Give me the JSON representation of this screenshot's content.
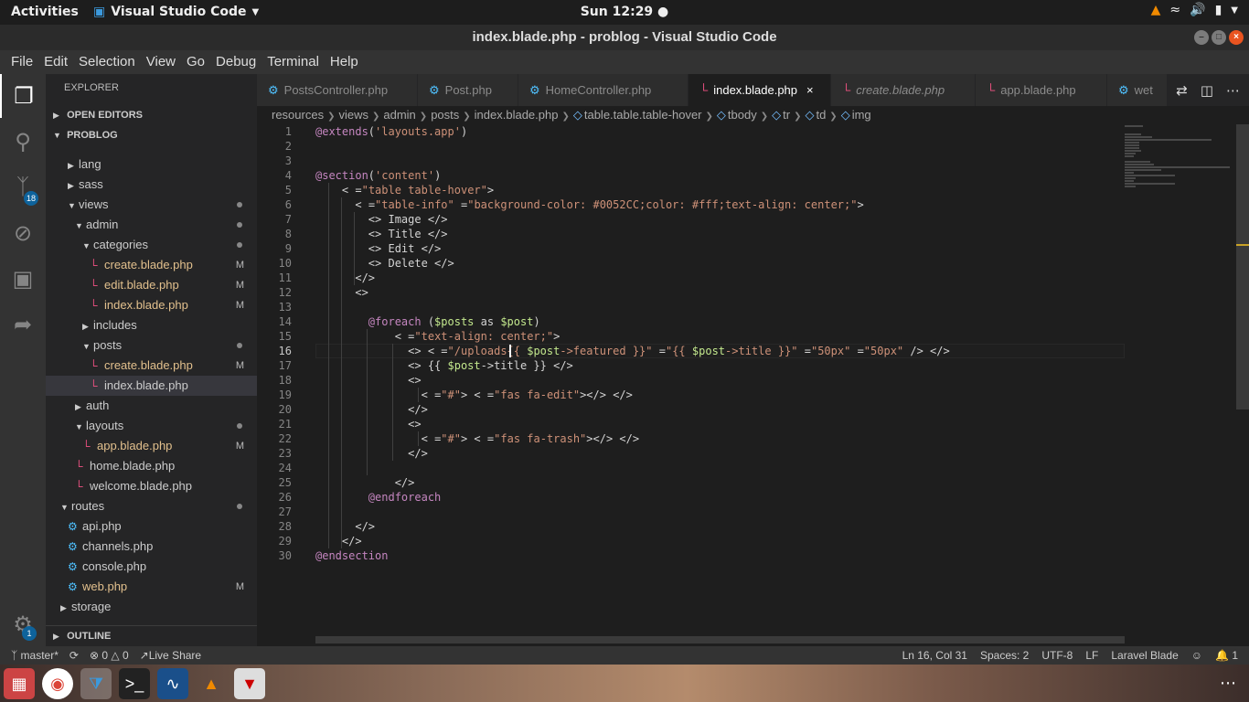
{
  "topbar": {
    "activities": "Activities",
    "app_name": "Visual Studio Code",
    "clock": "Sun 12:29 ●"
  },
  "window": {
    "title": "index.blade.php - problog - Visual Studio Code"
  },
  "menu": [
    "File",
    "Edit",
    "Selection",
    "View",
    "Go",
    "Debug",
    "Terminal",
    "Help"
  ],
  "activity": {
    "scm_badge": "18",
    "settings_badge": "1"
  },
  "sidebar": {
    "title": "EXPLORER",
    "open_editors": "OPEN EDITORS",
    "project": "PROBLOG",
    "outline": "OUTLINE",
    "rows": [
      {
        "label": "lang",
        "depth": 2,
        "kind": "folder",
        "open": false
      },
      {
        "label": "sass",
        "depth": 2,
        "kind": "folder",
        "open": false
      },
      {
        "label": "views",
        "depth": 2,
        "kind": "folder",
        "open": true,
        "dot": true
      },
      {
        "label": "admin",
        "depth": 3,
        "kind": "folder",
        "open": true,
        "dot": true
      },
      {
        "label": "categories",
        "depth": 4,
        "kind": "folder",
        "open": true,
        "dot": true
      },
      {
        "label": "create.blade.php",
        "depth": 5,
        "kind": "blade",
        "mod": "M"
      },
      {
        "label": "edit.blade.php",
        "depth": 5,
        "kind": "blade",
        "mod": "M"
      },
      {
        "label": "index.blade.php",
        "depth": 5,
        "kind": "blade",
        "mod": "M"
      },
      {
        "label": "includes",
        "depth": 4,
        "kind": "folder",
        "open": false
      },
      {
        "label": "posts",
        "depth": 4,
        "kind": "folder",
        "open": true,
        "dot": true
      },
      {
        "label": "create.blade.php",
        "depth": 5,
        "kind": "blade",
        "mod": "M"
      },
      {
        "label": "index.blade.php",
        "depth": 5,
        "kind": "blade",
        "selected": true
      },
      {
        "label": "auth",
        "depth": 3,
        "kind": "folder",
        "open": false
      },
      {
        "label": "layouts",
        "depth": 3,
        "kind": "folder",
        "open": true,
        "dot": true
      },
      {
        "label": "app.blade.php",
        "depth": 4,
        "kind": "blade",
        "mod": "M"
      },
      {
        "label": "home.blade.php",
        "depth": 3,
        "kind": "blade"
      },
      {
        "label": "welcome.blade.php",
        "depth": 3,
        "kind": "blade"
      },
      {
        "label": "routes",
        "depth": 1,
        "kind": "folder",
        "open": true,
        "dot": true
      },
      {
        "label": "api.php",
        "depth": 2,
        "kind": "php"
      },
      {
        "label": "channels.php",
        "depth": 2,
        "kind": "php"
      },
      {
        "label": "console.php",
        "depth": 2,
        "kind": "php"
      },
      {
        "label": "web.php",
        "depth": 2,
        "kind": "php",
        "mod": "M"
      },
      {
        "label": "storage",
        "depth": 1,
        "kind": "folder",
        "open": false
      }
    ]
  },
  "tabs": [
    {
      "label": "PostsController.php",
      "kind": "php"
    },
    {
      "label": "Post.php",
      "kind": "php"
    },
    {
      "label": "HomeController.php",
      "kind": "php"
    },
    {
      "label": "index.blade.php",
      "kind": "blade",
      "active": true
    },
    {
      "label": "create.blade.php",
      "kind": "blade",
      "italic": true
    },
    {
      "label": "app.blade.php",
      "kind": "blade"
    },
    {
      "label": "wet",
      "kind": "php"
    }
  ],
  "breadcrumb": [
    "resources",
    "views",
    "admin",
    "posts",
    "index.blade.php",
    "table.table.table-hover",
    "tbody",
    "tr",
    "td",
    "img"
  ],
  "editor": {
    "current_line": 16,
    "lines": [
      "@extends('layouts.app')",
      "",
      "",
      "@section('content')",
      "    <table class=\"table table-hover\">",
      "      <thead class=\"table-info\" style=\"background-color: #0052CC;color: #fff;text-align: center;\">",
      "        <th> Image </th>",
      "        <th> Title </th>",
      "        <th> Edit </th>",
      "        <th> Delete </th>",
      "      </thead>",
      "      <tbody>",
      "",
      "        @foreach ($posts as $post)",
      "            <tr style=\"text-align: center;\">",
      "              <td> <img src=\"/uploads{{ $post->featured }}\" alt=\"{{ $post->title }}\" width=\"50px\" height=\"50px\" /> </td>",
      "              <td> {{ $post->title }} </td>",
      "              <td>",
      "                <a href=\"#\"> <i class=\"fas fa-edit\"></i> </a>",
      "              </td>",
      "              <td>",
      "                <a href=\"#\"> <i class=\"fas fa-trash\"></i> </a>",
      "              </td>",
      "",
      "            </tr>",
      "        @endforeach",
      "",
      "      </tbody>",
      "    </table>",
      "@endsection"
    ]
  },
  "status": {
    "branch": "master*",
    "errors": "0",
    "warnings": "0",
    "live_share": "Live Share",
    "position": "Ln 16, Col 31",
    "spaces": "Spaces: 2",
    "encoding": "UTF-8",
    "eol": "LF",
    "language": "Laravel Blade",
    "notifications": "1"
  },
  "colors": {
    "accent": "#0e639c",
    "blade_icon": "#f55385",
    "php_icon": "#4fc1ff",
    "activity_bar": "#333333",
    "editor_bg": "#1e1e1e"
  }
}
